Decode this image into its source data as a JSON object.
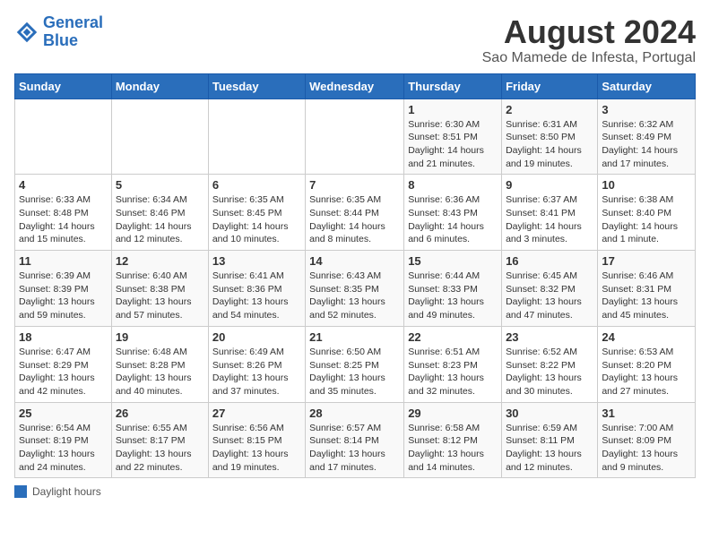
{
  "header": {
    "logo_line1": "General",
    "logo_line2": "Blue",
    "title": "August 2024",
    "subtitle": "Sao Mamede de Infesta, Portugal"
  },
  "columns": [
    "Sunday",
    "Monday",
    "Tuesday",
    "Wednesday",
    "Thursday",
    "Friday",
    "Saturday"
  ],
  "weeks": [
    [
      {
        "day": "",
        "info": ""
      },
      {
        "day": "",
        "info": ""
      },
      {
        "day": "",
        "info": ""
      },
      {
        "day": "",
        "info": ""
      },
      {
        "day": "1",
        "info": "Sunrise: 6:30 AM\nSunset: 8:51 PM\nDaylight: 14 hours and 21 minutes."
      },
      {
        "day": "2",
        "info": "Sunrise: 6:31 AM\nSunset: 8:50 PM\nDaylight: 14 hours and 19 minutes."
      },
      {
        "day": "3",
        "info": "Sunrise: 6:32 AM\nSunset: 8:49 PM\nDaylight: 14 hours and 17 minutes."
      }
    ],
    [
      {
        "day": "4",
        "info": "Sunrise: 6:33 AM\nSunset: 8:48 PM\nDaylight: 14 hours and 15 minutes."
      },
      {
        "day": "5",
        "info": "Sunrise: 6:34 AM\nSunset: 8:46 PM\nDaylight: 14 hours and 12 minutes."
      },
      {
        "day": "6",
        "info": "Sunrise: 6:35 AM\nSunset: 8:45 PM\nDaylight: 14 hours and 10 minutes."
      },
      {
        "day": "7",
        "info": "Sunrise: 6:35 AM\nSunset: 8:44 PM\nDaylight: 14 hours and 8 minutes."
      },
      {
        "day": "8",
        "info": "Sunrise: 6:36 AM\nSunset: 8:43 PM\nDaylight: 14 hours and 6 minutes."
      },
      {
        "day": "9",
        "info": "Sunrise: 6:37 AM\nSunset: 8:41 PM\nDaylight: 14 hours and 3 minutes."
      },
      {
        "day": "10",
        "info": "Sunrise: 6:38 AM\nSunset: 8:40 PM\nDaylight: 14 hours and 1 minute."
      }
    ],
    [
      {
        "day": "11",
        "info": "Sunrise: 6:39 AM\nSunset: 8:39 PM\nDaylight: 13 hours and 59 minutes."
      },
      {
        "day": "12",
        "info": "Sunrise: 6:40 AM\nSunset: 8:38 PM\nDaylight: 13 hours and 57 minutes."
      },
      {
        "day": "13",
        "info": "Sunrise: 6:41 AM\nSunset: 8:36 PM\nDaylight: 13 hours and 54 minutes."
      },
      {
        "day": "14",
        "info": "Sunrise: 6:43 AM\nSunset: 8:35 PM\nDaylight: 13 hours and 52 minutes."
      },
      {
        "day": "15",
        "info": "Sunrise: 6:44 AM\nSunset: 8:33 PM\nDaylight: 13 hours and 49 minutes."
      },
      {
        "day": "16",
        "info": "Sunrise: 6:45 AM\nSunset: 8:32 PM\nDaylight: 13 hours and 47 minutes."
      },
      {
        "day": "17",
        "info": "Sunrise: 6:46 AM\nSunset: 8:31 PM\nDaylight: 13 hours and 45 minutes."
      }
    ],
    [
      {
        "day": "18",
        "info": "Sunrise: 6:47 AM\nSunset: 8:29 PM\nDaylight: 13 hours and 42 minutes."
      },
      {
        "day": "19",
        "info": "Sunrise: 6:48 AM\nSunset: 8:28 PM\nDaylight: 13 hours and 40 minutes."
      },
      {
        "day": "20",
        "info": "Sunrise: 6:49 AM\nSunset: 8:26 PM\nDaylight: 13 hours and 37 minutes."
      },
      {
        "day": "21",
        "info": "Sunrise: 6:50 AM\nSunset: 8:25 PM\nDaylight: 13 hours and 35 minutes."
      },
      {
        "day": "22",
        "info": "Sunrise: 6:51 AM\nSunset: 8:23 PM\nDaylight: 13 hours and 32 minutes."
      },
      {
        "day": "23",
        "info": "Sunrise: 6:52 AM\nSunset: 8:22 PM\nDaylight: 13 hours and 30 minutes."
      },
      {
        "day": "24",
        "info": "Sunrise: 6:53 AM\nSunset: 8:20 PM\nDaylight: 13 hours and 27 minutes."
      }
    ],
    [
      {
        "day": "25",
        "info": "Sunrise: 6:54 AM\nSunset: 8:19 PM\nDaylight: 13 hours and 24 minutes."
      },
      {
        "day": "26",
        "info": "Sunrise: 6:55 AM\nSunset: 8:17 PM\nDaylight: 13 hours and 22 minutes."
      },
      {
        "day": "27",
        "info": "Sunrise: 6:56 AM\nSunset: 8:15 PM\nDaylight: 13 hours and 19 minutes."
      },
      {
        "day": "28",
        "info": "Sunrise: 6:57 AM\nSunset: 8:14 PM\nDaylight: 13 hours and 17 minutes."
      },
      {
        "day": "29",
        "info": "Sunrise: 6:58 AM\nSunset: 8:12 PM\nDaylight: 13 hours and 14 minutes."
      },
      {
        "day": "30",
        "info": "Sunrise: 6:59 AM\nSunset: 8:11 PM\nDaylight: 13 hours and 12 minutes."
      },
      {
        "day": "31",
        "info": "Sunrise: 7:00 AM\nSunset: 8:09 PM\nDaylight: 13 hours and 9 minutes."
      }
    ]
  ],
  "legend": {
    "box_label": "Daylight hours"
  }
}
